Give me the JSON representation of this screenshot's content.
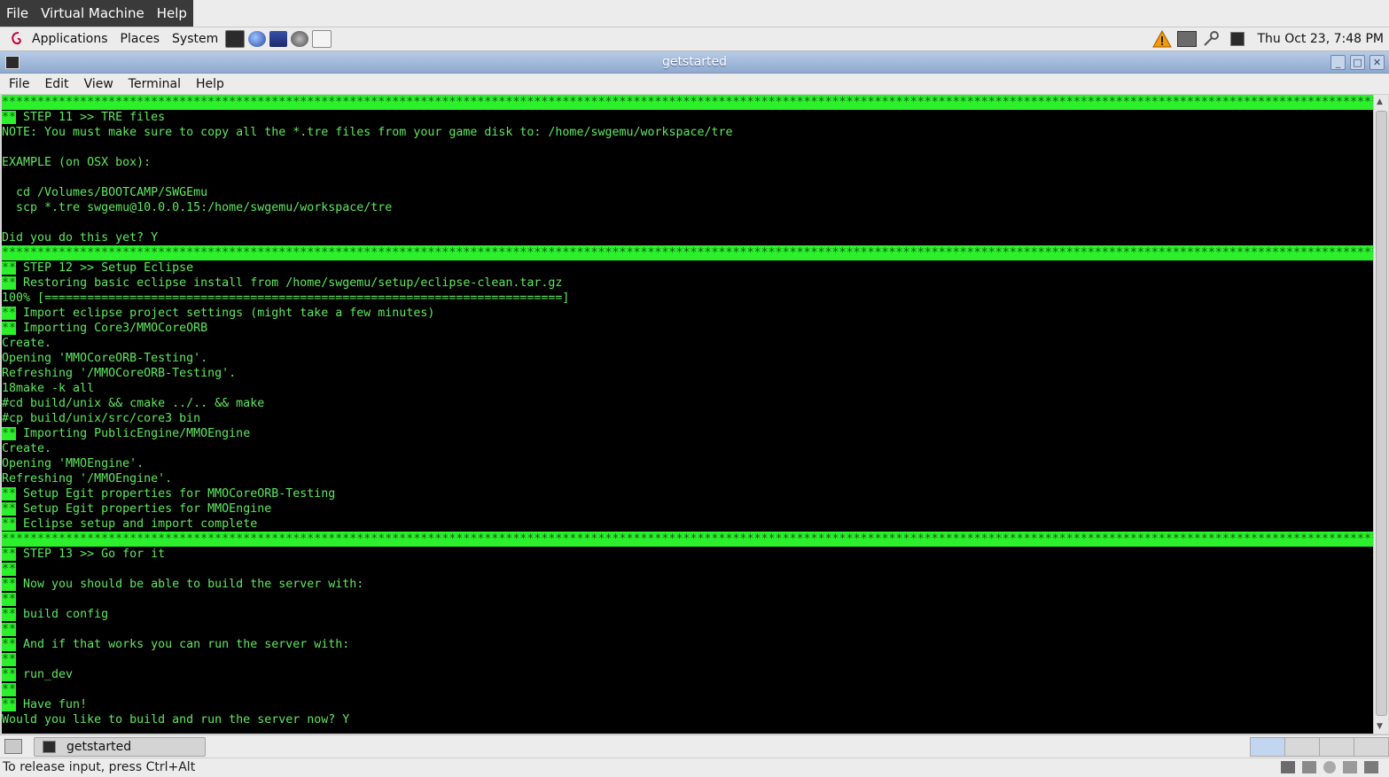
{
  "vm_menubar": {
    "items": [
      "File",
      "Virtual Machine",
      "Help"
    ]
  },
  "panel": {
    "menus": [
      "Applications",
      "Places",
      "System"
    ],
    "clock": "Thu Oct 23,  7:48 PM",
    "icons": [
      "debian-swirl-icon",
      "terminal-launcher-icon",
      "web-browser-icon",
      "eclipse-icon",
      "remote-desktop-icon",
      "notes-icon",
      "warning-icon",
      "network-icon",
      "key-icon",
      "display-icon"
    ]
  },
  "window": {
    "title": "getstarted",
    "menu": [
      "File",
      "Edit",
      "View",
      "Terminal",
      "Help"
    ]
  },
  "colors": {
    "terminal_bg": "#000000",
    "terminal_fg": "#5ee85e",
    "highlight": "#2df02d",
    "titlebar": "#9fb6d8"
  },
  "terminal": {
    "lines": [
      {
        "t": "****************************************************************************************************************************************************************************************************",
        "bar": true
      },
      {
        "m": "**",
        "t": " STEP 11 >> TRE files"
      },
      {
        "t": "NOTE: You must make sure to copy all the *.tre files from your game disk to: /home/swgemu/workspace/tre"
      },
      {
        "t": ""
      },
      {
        "t": "EXAMPLE (on OSX box):"
      },
      {
        "t": ""
      },
      {
        "t": "  cd /Volumes/BOOTCAMP/SWGEmu"
      },
      {
        "t": "  scp *.tre swgemu@10.0.0.15:/home/swgemu/workspace/tre"
      },
      {
        "t": ""
      },
      {
        "t": "Did you do this yet? Y"
      },
      {
        "t": "****************************************************************************************************************************************************************************************************",
        "bar": true
      },
      {
        "m": "**",
        "t": " STEP 12 >> Setup Eclipse"
      },
      {
        "m": "**",
        "t": " Restoring basic eclipse install from /home/swgemu/setup/eclipse-clean.tar.gz"
      },
      {
        "t": "100% [=========================================================================]"
      },
      {
        "m": "**",
        "t": " Import eclipse project settings (might take a few minutes)"
      },
      {
        "m": "**",
        "t": " Importing Core3/MMOCoreORB"
      },
      {
        "t": "Create."
      },
      {
        "t": "Opening 'MMOCoreORB-Testing'."
      },
      {
        "t": "Refreshing '/MMOCoreORB-Testing'."
      },
      {
        "t": "18make -k all"
      },
      {
        "t": "#cd build/unix && cmake ../.. && make"
      },
      {
        "t": "#cp build/unix/src/core3 bin"
      },
      {
        "m": "**",
        "t": " Importing PublicEngine/MMOEngine"
      },
      {
        "t": "Create."
      },
      {
        "t": "Opening 'MMOEngine'."
      },
      {
        "t": "Refreshing '/MMOEngine'."
      },
      {
        "m": "**",
        "t": " Setup Egit properties for MMOCoreORB-Testing"
      },
      {
        "m": "**",
        "t": " Setup Egit properties for MMOEngine"
      },
      {
        "m": "**",
        "t": " Eclipse setup and import complete"
      },
      {
        "t": "****************************************************************************************************************************************************************************************************",
        "bar": true
      },
      {
        "m": "**",
        "t": " STEP 13 >> Go for it"
      },
      {
        "m": "**",
        "t": ""
      },
      {
        "m": "**",
        "t": " Now you should be able to build the server with:"
      },
      {
        "m": "**",
        "t": ""
      },
      {
        "m": "**",
        "t": " build config"
      },
      {
        "m": "**",
        "t": ""
      },
      {
        "m": "**",
        "t": " And if that works you can run the server with:"
      },
      {
        "m": "**",
        "t": ""
      },
      {
        "m": "**",
        "t": " run_dev"
      },
      {
        "m": "**",
        "t": ""
      },
      {
        "m": "**",
        "t": " Have fun!"
      },
      {
        "t": "Would you like to build and run the server now? Y"
      }
    ]
  },
  "taskbar": {
    "task": "getstarted"
  },
  "statusbar": {
    "text": "To release input, press Ctrl+Alt"
  }
}
